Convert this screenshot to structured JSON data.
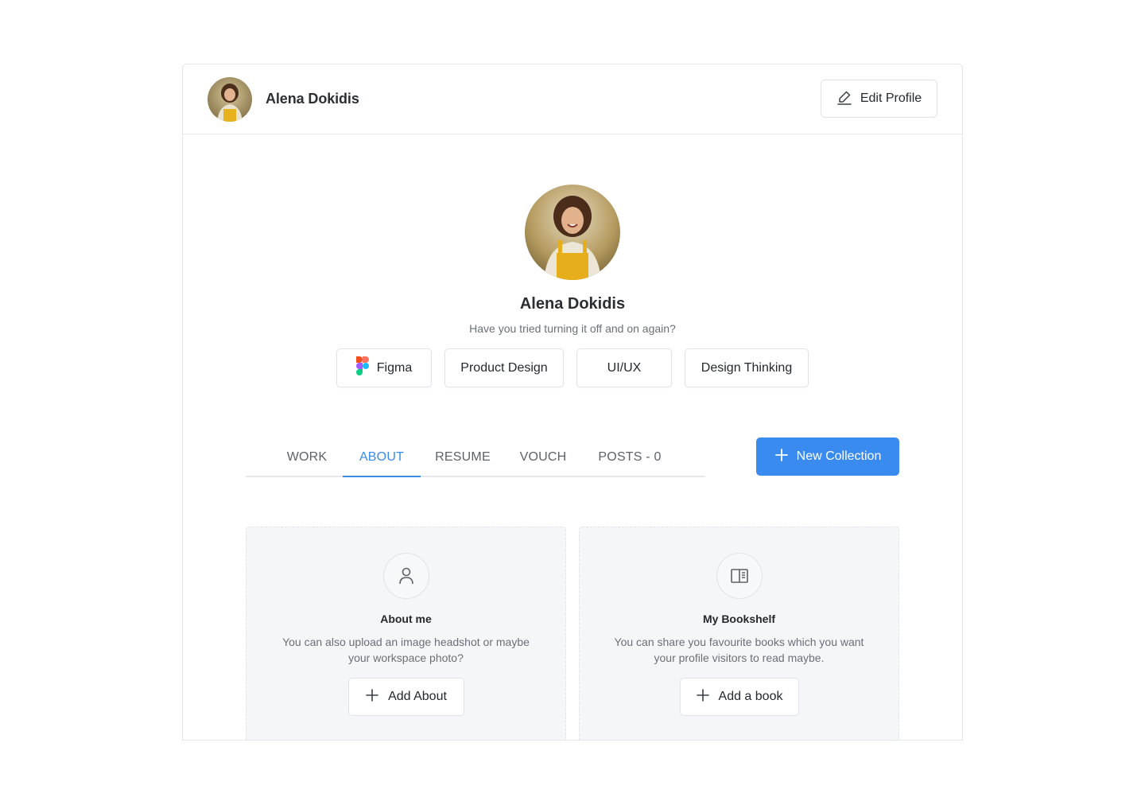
{
  "header": {
    "name": "Alena Dokidis",
    "edit_label": "Edit Profile"
  },
  "profile": {
    "name": "Alena Dokidis",
    "tagline": "Have you tried turning it off and on again?",
    "skills": [
      "Figma",
      "Product Design",
      "UI/UX",
      "Design Thinking"
    ]
  },
  "tabs": [
    "WORK",
    "ABOUT",
    "RESUME",
    "VOUCH",
    "POSTS - 0"
  ],
  "active_tab": "ABOUT",
  "new_collection_label": "New Collection",
  "cards": [
    {
      "icon": "user-icon",
      "title": "About me",
      "description": "You can also upload an image headshot or maybe your workspace photo?",
      "button": "Add About"
    },
    {
      "icon": "book-icon",
      "title": "My Bookshelf",
      "description": "You can share you favourite books which you want your profile visitors to read maybe.",
      "button": "Add a book"
    }
  ],
  "colors": {
    "accent": "#3a8bef",
    "card_bg": "#f5f6f7",
    "border": "#e1e3e6"
  }
}
